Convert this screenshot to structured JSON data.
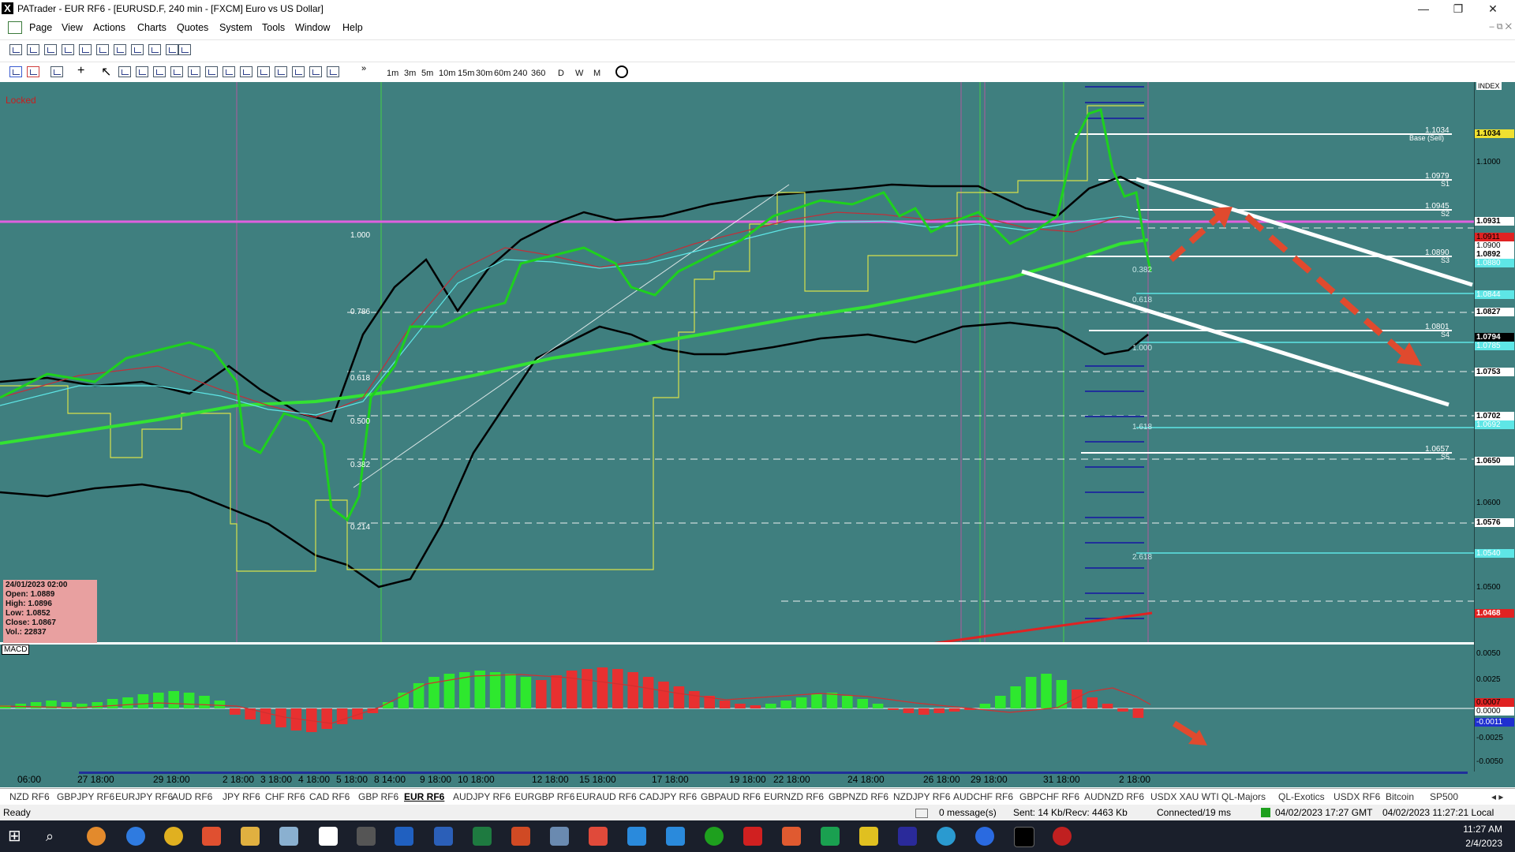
{
  "window": {
    "app_icon": "X",
    "title": "PATrader - EUR RF6 - [EURUSD.F, 240 min - [FXCM] Euro vs US Dollar]",
    "buttons": [
      "—",
      "❐",
      "✕"
    ],
    "mdi_buttons": "–   ⧉   ✕"
  },
  "menu": [
    "Page",
    "View",
    "Actions",
    "Charts",
    "Quotes",
    "System",
    "Tools",
    "Window",
    "Help"
  ],
  "toolbar": {
    "timeframes": [
      "1m",
      "3m",
      "5m",
      "10m",
      "15m",
      "30m",
      "60m",
      "240",
      "360",
      "D",
      "W",
      "M"
    ]
  },
  "chart": {
    "locked_label": "Locked",
    "macd_label": "MACD",
    "index_label": "INDEX",
    "ohlc_box": {
      "date": "24/01/2023 02:00",
      "open": "Open: 1.0889",
      "high": "High: 1.0896",
      "low": "Low: 1.0852",
      "close": "Close: 1.0867",
      "vol": "Vol.: 22837"
    },
    "fib_left": [
      "1.000",
      "0.786",
      "0.618",
      "0.500",
      "0.382",
      "0.214"
    ],
    "fib_right": [
      "0.382",
      "0.618",
      "1.000",
      "1.618",
      "2.618"
    ],
    "pivot_labels": [
      "1.1034",
      "Base (Sell)",
      "1.0979",
      "S1",
      "1.0945",
      "S2",
      "1.0890",
      "S3",
      "1.0801",
      "S4",
      "1.0657",
      "S5"
    ],
    "price_scale": [
      "1.1034",
      "1.1000",
      "1.0931",
      "1.0911",
      "1.0900",
      "1.0892",
      "1.0880",
      "1.0844",
      "1.0827",
      "1.0794",
      "1.0785",
      "1.0753",
      "1.0702",
      "1.0692",
      "1.0650",
      "1.0600",
      "1.0576",
      "1.0540",
      "1.0500",
      "1.0468"
    ],
    "macd_scale": [
      "0.0050",
      "0.0025",
      "0.0007",
      "0.0000",
      "-0.0011",
      "-0.0025",
      "-0.0050"
    ],
    "time_labels": [
      "06:00",
      "27 18:00",
      "29 18:00",
      "2 18:00",
      "3 18:00",
      "4 18:00",
      "5 18:00",
      "8 14:00",
      "9 18:00",
      "10 18:00",
      "12 18:00",
      "15 18:00",
      "17 18:00",
      "19 18:00",
      "22 18:00",
      "24 18:00",
      "26 18:00",
      "29 18:00",
      "31 18:00",
      "2 18:00"
    ]
  },
  "tabs": [
    "NZD RF6",
    "GBPJPY RF6",
    "EURJPY RF6",
    "AUD RF6",
    "JPY RF6",
    "CHF RF6",
    "CAD RF6",
    "GBP RF6",
    "EUR RF6",
    "AUDJPY RF6",
    "EURGBP RF6",
    "EURAUD RF6",
    "CADJPY RF6",
    "GBPAUD RF6",
    "EURNZD RF6",
    "GBPNZD RF6",
    "NZDJPY RF6",
    "AUDCHF RF6",
    "GBPCHF RF6",
    "AUDNZD RF6",
    "USDX XAU WTI",
    "QL-Majors",
    "QL-Exotics",
    "USDX RF6",
    "Bitcoin",
    "SP500"
  ],
  "active_tab": "EUR RF6",
  "status": {
    "ready": "Ready",
    "messages": "0 message(s)",
    "traffic": "Sent: 14 Kb/Recv: 4463 Kb",
    "connection": "Connected/19 ms",
    "gmt": "04/02/2023 17:27 GMT",
    "local": "04/02/2023 11:27:21 Local"
  },
  "taskbar": {
    "time": "11:27 AM",
    "date": "2/4/2023"
  }
}
